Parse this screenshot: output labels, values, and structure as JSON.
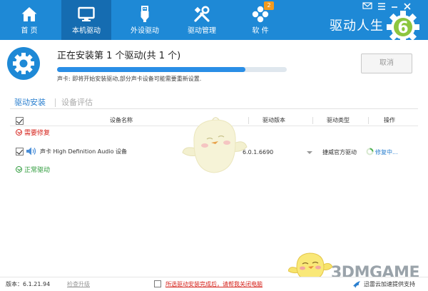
{
  "nav": {
    "tabs": [
      {
        "label": "首 页",
        "icon": "home-icon"
      },
      {
        "label": "本机驱动",
        "icon": "monitor-icon"
      },
      {
        "label": "外设驱动",
        "icon": "usb-icon"
      },
      {
        "label": "驱动管理",
        "icon": "tools-icon"
      },
      {
        "label": "软 件",
        "icon": "apps-icon",
        "badge": "2"
      }
    ],
    "brand": "驱动人生",
    "brand_logo_digit": "6",
    "accent": "#1e89d6",
    "active_tab_bg": "#156cb1"
  },
  "status": {
    "title": "正在安装第 1 个驱动(共 1 个)",
    "progress": 0.82,
    "subtitle": "声卡: 即将开始安装驱动,部分声卡设备可能需要重新设置.",
    "cancel_label": "取消"
  },
  "subtabs": {
    "install": "驱动安装",
    "evaluate": "设备评估"
  },
  "table": {
    "headers": {
      "name": "设备名称",
      "version": "驱动版本",
      "type": "驱动类型",
      "action": "操作"
    },
    "group_repair": "需要修复",
    "group_normal": "正常驱动",
    "row": {
      "name": "声卡 High Definition Audio 设备",
      "version": "6.0.1.6690",
      "type": "捷威官方驱动",
      "action": "修复中..."
    }
  },
  "footer": {
    "version": "版本：6.1.21.94",
    "check_update": "检查升级",
    "shutdown_option": "所选驱动安装完成后，请帮我关闭电脑",
    "support": "迅雷云加速提供支持",
    "watermark": "3DMGAME"
  }
}
